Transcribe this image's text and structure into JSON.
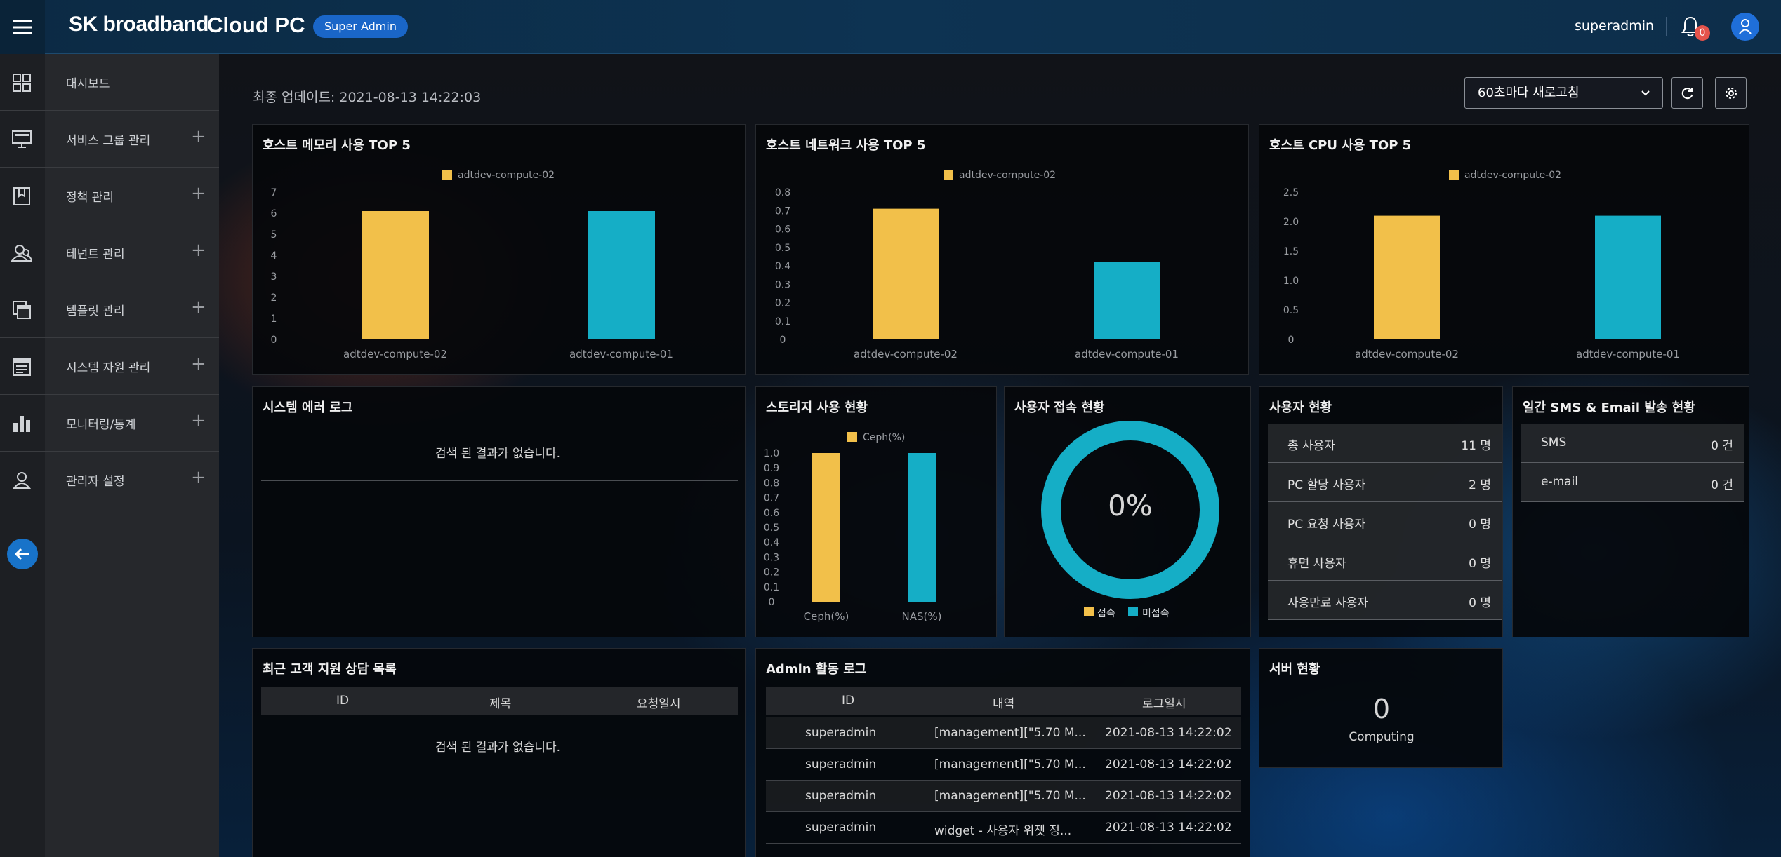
{
  "header": {
    "logo_brand": "SK broadband",
    "logo_product": "Cloud PC",
    "role_badge": "Super Admin",
    "username": "superadmin",
    "notification_count": "0"
  },
  "sidebar": {
    "items": [
      {
        "label": "대시보드",
        "icon": "grid-icon",
        "expandable": false
      },
      {
        "label": "서비스 그룹 관리",
        "icon": "monitor-icon",
        "expandable": true
      },
      {
        "label": "정책 관리",
        "icon": "bookmark-icon",
        "expandable": true
      },
      {
        "label": "테넌트 관리",
        "icon": "users-icon",
        "expandable": true
      },
      {
        "label": "템플릿 관리",
        "icon": "layers-icon",
        "expandable": true
      },
      {
        "label": "시스템 자원 관리",
        "icon": "server-icon",
        "expandable": true
      },
      {
        "label": "모니터링/통계",
        "icon": "bar-chart-icon",
        "expandable": true
      },
      {
        "label": "관리자 설정",
        "icon": "user-cog-icon",
        "expandable": true
      }
    ]
  },
  "toolbar": {
    "last_update": "최종 업데이트: 2021-08-13 14:22:03",
    "refresh_interval": "60초마다 새로고침"
  },
  "panels": {
    "memory": {
      "title": "호스트 메모리 사용 TOP 5"
    },
    "network": {
      "title": "호스트 네트워크 사용 TOP 5"
    },
    "cpu": {
      "title": "호스트 CPU 사용 TOP 5"
    },
    "error_log": {
      "title": "시스템 에러 로그",
      "empty": "검색 된 결과가 없습니다."
    },
    "storage": {
      "title": "스토리지 사용 현황"
    },
    "user_access": {
      "title": "사용자 접속 현황",
      "percent": "0%",
      "legend_on": "접속",
      "legend_off": "미접속"
    },
    "user_status": {
      "title": "사용자 현황",
      "rows": [
        {
          "label": "총 사용자",
          "value": "11 명"
        },
        {
          "label": "PC 할당 사용자",
          "value": "2 명"
        },
        {
          "label": "PC 요청 사용자",
          "value": "0 명"
        },
        {
          "label": "휴면 사용자",
          "value": "0 명"
        },
        {
          "label": "사용만료 사용자",
          "value": "0 명"
        }
      ]
    },
    "sms": {
      "title": "일간 SMS & Email 발송 현황",
      "rows": [
        {
          "label": "SMS",
          "value": "0 건"
        },
        {
          "label": "e-mail",
          "value": "0 건"
        }
      ]
    },
    "support": {
      "title": "최근 고객 지원 상담 목록",
      "columns": [
        "ID",
        "제목",
        "요청일시"
      ],
      "empty": "검색 된 결과가 없습니다."
    },
    "admin_log": {
      "title": "Admin 활동 로그",
      "columns": [
        "ID",
        "내역",
        "로그일시"
      ],
      "rows": [
        {
          "id": "superadmin",
          "detail": "[management][\"5.70 M...",
          "time": "2021-08-13 14:22:02"
        },
        {
          "id": "superadmin",
          "detail": "[management][\"5.70 M...",
          "time": "2021-08-13 14:22:02"
        },
        {
          "id": "superadmin",
          "detail": "[management][\"5.70 M...",
          "time": "2021-08-13 14:22:02"
        },
        {
          "id": "superadmin",
          "detail": "widget - 사용자 위젯 정...",
          "time": "2021-08-13 14:22:02"
        }
      ]
    },
    "server": {
      "title": "서버 현황",
      "count": "0",
      "label": "Computing"
    }
  },
  "colors": {
    "yellow": "#f2c04a",
    "teal": "#15aec6",
    "accent_blue": "#1a66c8"
  },
  "chart_data": [
    {
      "type": "bar",
      "title": "호스트 메모리 사용 TOP 5",
      "categories": [
        "adtdev-compute-02",
        "adtdev-compute-01"
      ],
      "values": [
        6.1,
        6.1
      ],
      "legend": [
        "adtdev-compute-02"
      ],
      "yticks": [
        "7",
        "6",
        "5",
        "4",
        "3",
        "2",
        "1",
        "0"
      ],
      "ylim": [
        0,
        7
      ]
    },
    {
      "type": "bar",
      "title": "호스트 네트워크 사용 TOP 5",
      "categories": [
        "adtdev-compute-02",
        "adtdev-compute-01"
      ],
      "values": [
        0.71,
        0.42
      ],
      "legend": [
        "adtdev-compute-02"
      ],
      "yticks": [
        "0.8",
        "0.7",
        "0.6",
        "0.5",
        "0.4",
        "0.3",
        "0.2",
        "0.1",
        "0"
      ],
      "ylim": [
        0,
        0.8
      ]
    },
    {
      "type": "bar",
      "title": "호스트 CPU 사용 TOP 5",
      "categories": [
        "adtdev-compute-02",
        "adtdev-compute-01"
      ],
      "values": [
        2.1,
        2.1
      ],
      "legend": [
        "adtdev-compute-02"
      ],
      "yticks": [
        "2.5",
        "2.0",
        "1.5",
        "1.0",
        "0.5",
        "0"
      ],
      "ylim": [
        0,
        2.5
      ]
    },
    {
      "type": "bar",
      "title": "스토리지 사용 현황",
      "categories": [
        "Ceph(%)",
        "NAS(%)"
      ],
      "values": [
        1.0,
        1.0
      ],
      "legend": [
        "Ceph(%)"
      ],
      "yticks": [
        "1.0",
        "0.9",
        "0.8",
        "0.7",
        "0.6",
        "0.5",
        "0.4",
        "0.3",
        "0.2",
        "0.1",
        "0"
      ],
      "ylim": [
        0,
        1.0
      ]
    }
  ]
}
